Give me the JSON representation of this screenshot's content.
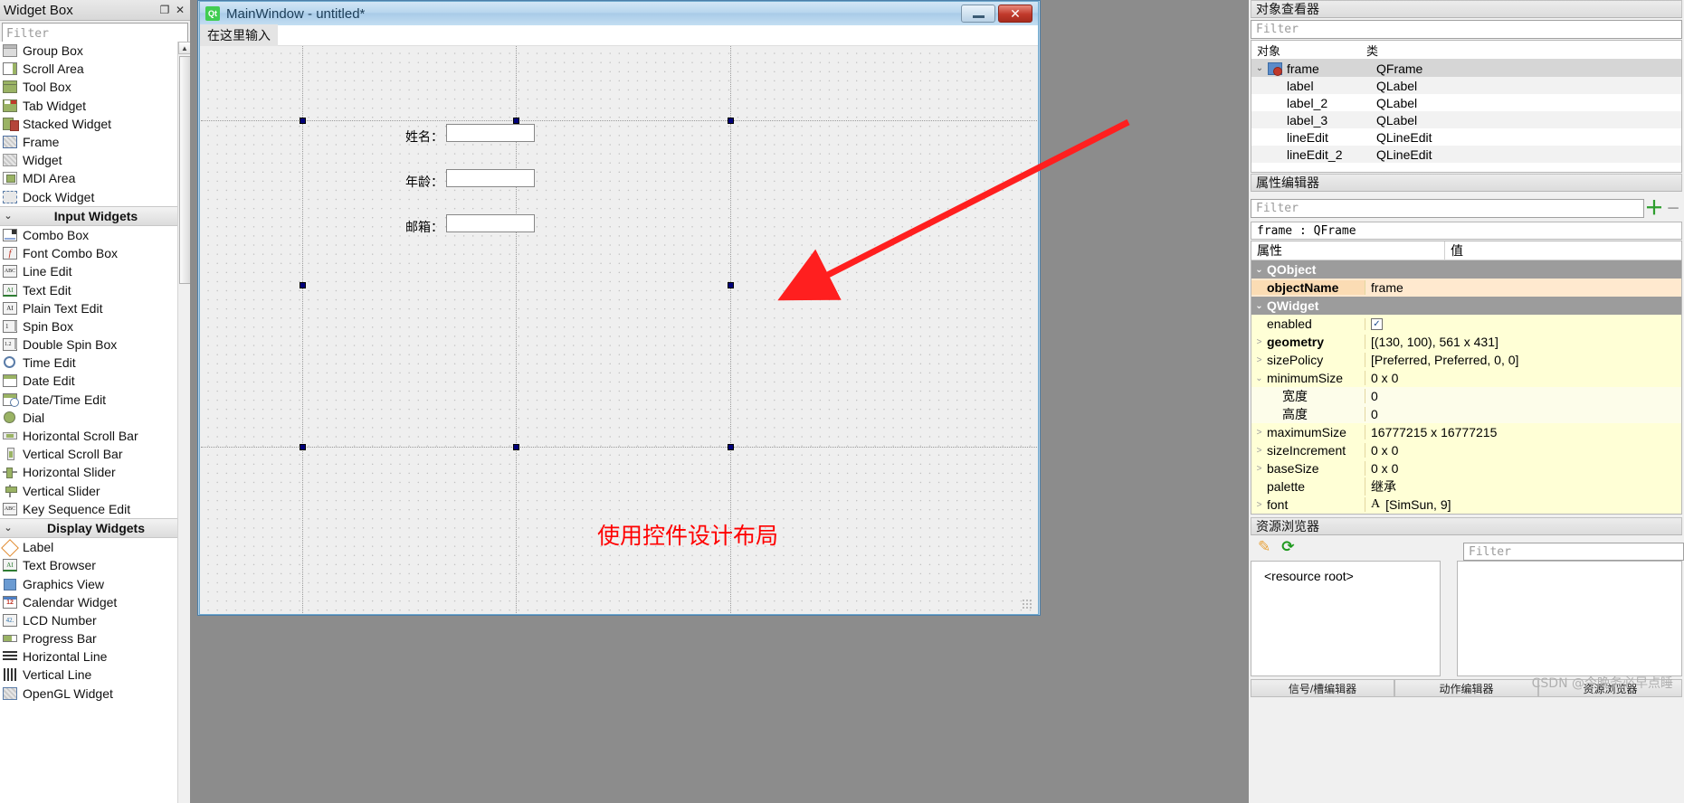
{
  "widget_box": {
    "title": "Widget Box",
    "float_icon": "float-icon",
    "close_icon": "close-icon",
    "filter_placeholder": "Filter",
    "groups": [
      {
        "category": null,
        "items": [
          {
            "label": "Group Box",
            "icon": "group-box-icon"
          },
          {
            "label": "Scroll Area",
            "icon": "scroll-area-icon"
          },
          {
            "label": "Tool Box",
            "icon": "tool-box-icon"
          },
          {
            "label": "Tab Widget",
            "icon": "tab-widget-icon"
          },
          {
            "label": "Stacked Widget",
            "icon": "stacked-widget-icon"
          },
          {
            "label": "Frame",
            "icon": "frame-icon"
          },
          {
            "label": "Widget",
            "icon": "widget-icon"
          },
          {
            "label": "MDI Area",
            "icon": "mdi-area-icon"
          },
          {
            "label": "Dock Widget",
            "icon": "dock-widget-icon"
          }
        ]
      },
      {
        "category": "Input Widgets",
        "items": [
          {
            "label": "Combo Box",
            "icon": "combo-box-icon"
          },
          {
            "label": "Font Combo Box",
            "icon": "font-combo-box-icon"
          },
          {
            "label": "Line Edit",
            "icon": "line-edit-icon"
          },
          {
            "label": "Text Edit",
            "icon": "text-edit-icon"
          },
          {
            "label": "Plain Text Edit",
            "icon": "plain-text-edit-icon"
          },
          {
            "label": "Spin Box",
            "icon": "spin-box-icon"
          },
          {
            "label": "Double Spin Box",
            "icon": "double-spin-box-icon"
          },
          {
            "label": "Time Edit",
            "icon": "time-edit-icon"
          },
          {
            "label": "Date Edit",
            "icon": "date-edit-icon"
          },
          {
            "label": "Date/Time Edit",
            "icon": "date-time-edit-icon"
          },
          {
            "label": "Dial",
            "icon": "dial-icon"
          },
          {
            "label": "Horizontal Scroll Bar",
            "icon": "horizontal-scroll-bar-icon"
          },
          {
            "label": "Vertical Scroll Bar",
            "icon": "vertical-scroll-bar-icon"
          },
          {
            "label": "Horizontal Slider",
            "icon": "horizontal-slider-icon"
          },
          {
            "label": "Vertical Slider",
            "icon": "vertical-slider-icon"
          },
          {
            "label": "Key Sequence Edit",
            "icon": "key-sequence-edit-icon"
          }
        ]
      },
      {
        "category": "Display Widgets",
        "items": [
          {
            "label": "Label",
            "icon": "label-icon"
          },
          {
            "label": "Text Browser",
            "icon": "text-browser-icon"
          },
          {
            "label": "Graphics View",
            "icon": "graphics-view-icon"
          },
          {
            "label": "Calendar Widget",
            "icon": "calendar-widget-icon"
          },
          {
            "label": "LCD Number",
            "icon": "lcd-number-icon"
          },
          {
            "label": "Progress Bar",
            "icon": "progress-bar-icon"
          },
          {
            "label": "Horizontal Line",
            "icon": "horizontal-line-icon"
          },
          {
            "label": "Vertical Line",
            "icon": "vertical-line-icon"
          },
          {
            "label": "OpenGL Widget",
            "icon": "opengl-widget-icon"
          }
        ]
      }
    ]
  },
  "form_window": {
    "title": "MainWindow - untitled*",
    "logo_text": "Qt",
    "menu_placeholder": "在这里输入",
    "minimize_label": "minimize-icon",
    "close_label": "✕",
    "fields": [
      {
        "label": "姓名：",
        "value": ""
      },
      {
        "label": "年龄：",
        "value": ""
      },
      {
        "label": "邮箱：",
        "value": ""
      }
    ],
    "annotation_text": "使用控件设计布局",
    "annotation_color": "#ff0000"
  },
  "object_inspector": {
    "title": "对象查看器",
    "filter_placeholder": "Filter",
    "columns": [
      "对象",
      "类"
    ],
    "rows": [
      {
        "name": "frame",
        "class": "QFrame",
        "selected": true,
        "expandable": true
      },
      {
        "name": "label",
        "class": "QLabel",
        "selected": false,
        "expandable": false
      },
      {
        "name": "label_2",
        "class": "QLabel",
        "selected": false,
        "expandable": false
      },
      {
        "name": "label_3",
        "class": "QLabel",
        "selected": false,
        "expandable": false
      },
      {
        "name": "lineEdit",
        "class": "QLineEdit",
        "selected": false,
        "expandable": false
      },
      {
        "name": "lineEdit_2",
        "class": "QLineEdit",
        "selected": false,
        "expandable": false
      }
    ],
    "highlight_color": "#ff1f1f"
  },
  "property_editor": {
    "title": "属性编辑器",
    "filter_placeholder": "Filter",
    "add_icon": "add-icon",
    "remove_icon": "remove-icon",
    "target": "frame : QFrame",
    "columns": [
      "属性",
      "值"
    ],
    "rows": [
      {
        "key": "QObject",
        "value": "",
        "type": "group"
      },
      {
        "key": "objectName",
        "value": "frame",
        "type": "orange",
        "bold": true
      },
      {
        "key": "QWidget",
        "value": "",
        "type": "group"
      },
      {
        "key": "enabled",
        "value": "",
        "type": "yellow",
        "control": "checkbox",
        "checked": true
      },
      {
        "key": "geometry",
        "value": "[(130, 100), 561 x 431]",
        "type": "yellow",
        "bold": true,
        "expandable": true
      },
      {
        "key": "sizePolicy",
        "value": "[Preferred, Preferred, 0, 0]",
        "type": "yellow",
        "expandable": true
      },
      {
        "key": "minimumSize",
        "value": "0 x 0",
        "type": "yellow",
        "expanded": true
      },
      {
        "key": "宽度",
        "value": "0",
        "type": "yellow-sub"
      },
      {
        "key": "高度",
        "value": "0",
        "type": "yellow-sub"
      },
      {
        "key": "maximumSize",
        "value": "16777215 x 16777215",
        "type": "yellow",
        "expandable": true
      },
      {
        "key": "sizeIncrement",
        "value": "0 x 0",
        "type": "yellow",
        "expandable": true
      },
      {
        "key": "baseSize",
        "value": "0 x 0",
        "type": "yellow",
        "expandable": true
      },
      {
        "key": "palette",
        "value": "继承",
        "type": "yellow"
      },
      {
        "key": "font",
        "value": "[SimSun, 9]",
        "type": "yellow",
        "expandable": true,
        "prefix": "A"
      }
    ]
  },
  "resource_browser": {
    "title": "资源浏览器",
    "edit_icon": "pencil-icon",
    "reload_icon": "reload-icon",
    "root_label": "<resource root>",
    "filter_placeholder": "Filter"
  },
  "bottom_tabs": [
    "信号/槽编辑器",
    "动作编辑器",
    "资源浏览器"
  ],
  "watermark": "CSDN @今晚务必早点睡"
}
